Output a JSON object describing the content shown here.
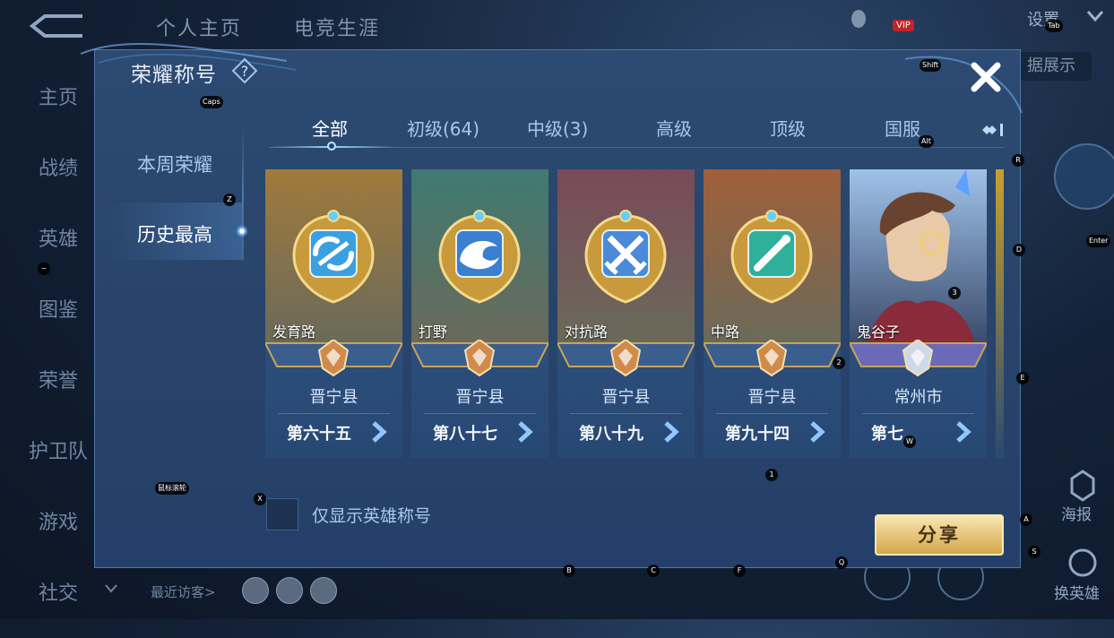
{
  "background": {
    "top_tabs": [
      "个人主页",
      "电竞生涯"
    ],
    "left_nav": [
      "主页",
      "战绩",
      "英雄",
      "图鉴",
      "荣誉",
      "护卫队",
      "游戏",
      "社交"
    ],
    "settings_label": "设置",
    "vip_label": "VIP",
    "data_show_label": "据展示",
    "poster_label": "海报",
    "swap_hero_label": "换英雄",
    "recent_visitors_label": "最近访客>"
  },
  "modal": {
    "title": "荣耀称号",
    "side_tabs": [
      {
        "label": "本周荣耀",
        "active": false
      },
      {
        "label": "历史最高",
        "active": true
      }
    ],
    "tabs": [
      {
        "label": "全部",
        "active": true
      },
      {
        "label": "初级(64)",
        "active": false
      },
      {
        "label": "中级(3)",
        "active": false
      },
      {
        "label": "高级",
        "active": false
      },
      {
        "label": "顶级",
        "active": false
      },
      {
        "label": "国服",
        "active": false
      }
    ],
    "cards": [
      {
        "name": "发育路",
        "region": "晋宁县",
        "rank": "第六十五",
        "tier": "bronze",
        "art_color": "#a07a3c",
        "icon": "dash-icon"
      },
      {
        "name": "打野",
        "region": "晋宁县",
        "rank": "第八十七",
        "tier": "bronze",
        "art_color": "#3f7a72",
        "icon": "dragon-icon"
      },
      {
        "name": "对抗路",
        "region": "晋宁县",
        "rank": "第八十九",
        "tier": "bronze",
        "art_color": "#7a4a5a",
        "icon": "crossed-swords-icon"
      },
      {
        "name": "中路",
        "region": "晋宁县",
        "rank": "第九十四",
        "tier": "bronze",
        "art_color": "#a0603a",
        "icon": "staff-icon"
      },
      {
        "name": "鬼谷子",
        "region": "常州市",
        "rank": "第七",
        "tier": "silver",
        "art_color": "#6a7fa6",
        "icon": "hero-portrait"
      }
    ],
    "checkbox_label": "仅显示英雄称号",
    "checkbox_checked": false,
    "share_label": "分享"
  },
  "key_hints": {
    "caps": "Caps",
    "shift": "Shift",
    "tab": "Tab",
    "alt": "Alt",
    "enter": "Enter",
    "r": "R",
    "d": "D",
    "e": "E",
    "z": "Z",
    "x": "X",
    "a": "A",
    "s": "S",
    "q": "Q",
    "b": "B",
    "c": "C",
    "f": "F",
    "w": "W",
    "n1": "1",
    "n2": "2",
    "n3": "3",
    "tilde": "~",
    "mouse_wheel": "鼠标滚轮"
  },
  "colors": {
    "modal_bg": "#29456b",
    "accent_gold": "#e7c57a",
    "tab_inactive": "#a9c6ea",
    "tab_active": "#ffffff"
  }
}
